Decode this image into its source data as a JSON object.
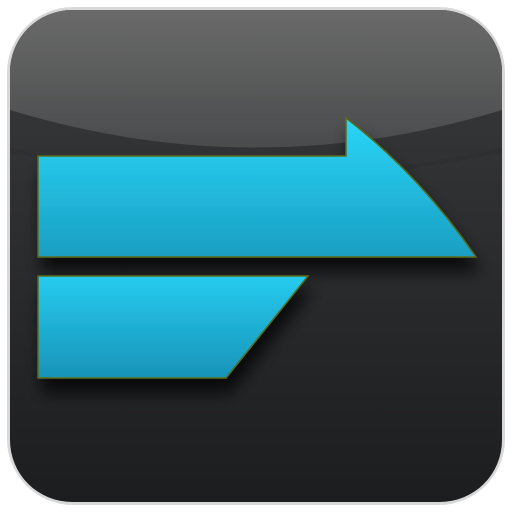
{
  "icon": {
    "name": "forward-arrow-app-icon",
    "glyph": "arrow-right-with-lower-bar",
    "colors": {
      "background": "#ffffff",
      "tile_top": "#5c5c5c",
      "tile_bottom": "#1c1d1f",
      "tile_border": "#cfcfcf",
      "arrow_light": "#29d4f7",
      "arrow_dark": "#1a9cc0",
      "arrow_outline": "#5a6a1a"
    }
  }
}
